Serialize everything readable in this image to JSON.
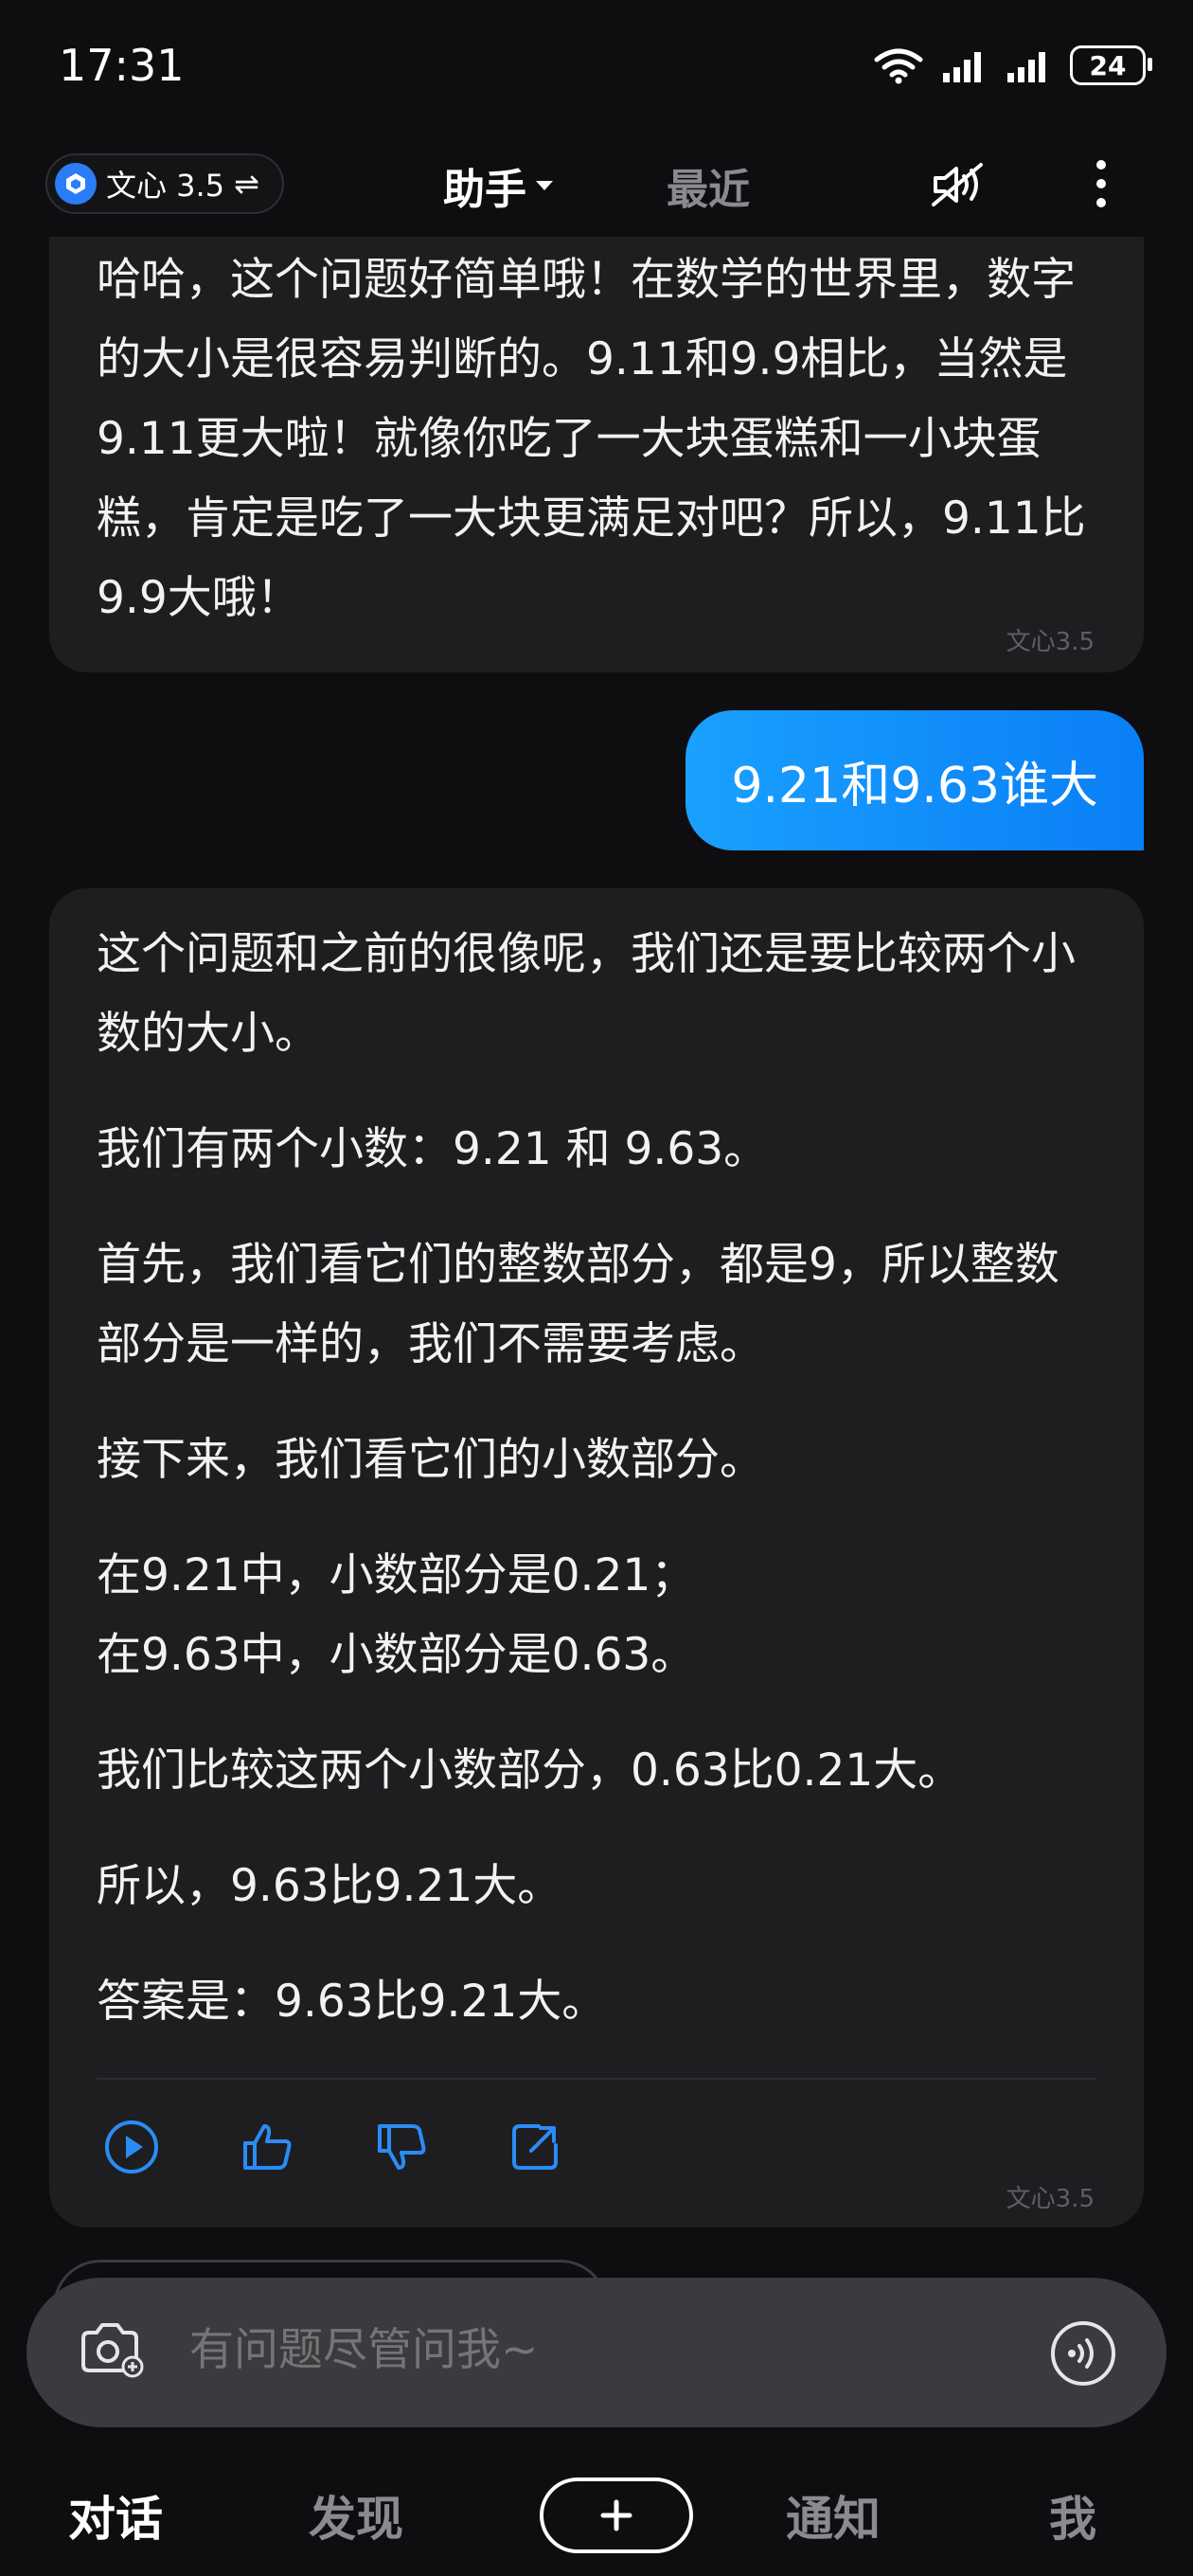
{
  "status_bar": {
    "time": "17:31",
    "battery": "24"
  },
  "header": {
    "model_label": "文心 3.5",
    "tab_assistant": "助手",
    "tab_recent": "最近"
  },
  "conversation": {
    "bot_reply_1": "哈哈，这个问题好简单哦！在数学的世界里，数字的大小是很容易判断的。9.11和9.9相比，当然是9.11更大啦！就像你吃了一大块蛋糕和一小块蛋糕，肯定是吃了一大块更满足对吧？所以，9.11比9.9大哦！",
    "user_message": "9.21和9.63谁大",
    "bot_reply_2": [
      "这个问题和之前的很像呢，我们还是要比较两个小数的大小。",
      "我们有两个小数：9.21 和 9.63。",
      "首先，我们看它们的整数部分，都是9，所以整数部分是一样的，我们不需要考虑。",
      "接下来，我们看它们的小数部分。",
      "在9.21中，小数部分是0.21；",
      "在9.63中，小数部分是0.63。",
      "我们比较这两个小数部分，0.63比0.21大。",
      "所以，9.63比9.21大。",
      "答案是：9.63比9.21大。"
    ],
    "model_tag": "文心3.5"
  },
  "input": {
    "placeholder": "有问题尽管问我~"
  },
  "bottom_nav": {
    "chat": "对话",
    "discover": "发现",
    "notice": "通知",
    "me": "我"
  },
  "icons": {
    "actions": [
      "play-icon",
      "thumbs-up-icon",
      "thumbs-down-icon",
      "share-icon"
    ],
    "accent_color": "#2a8cf7"
  }
}
